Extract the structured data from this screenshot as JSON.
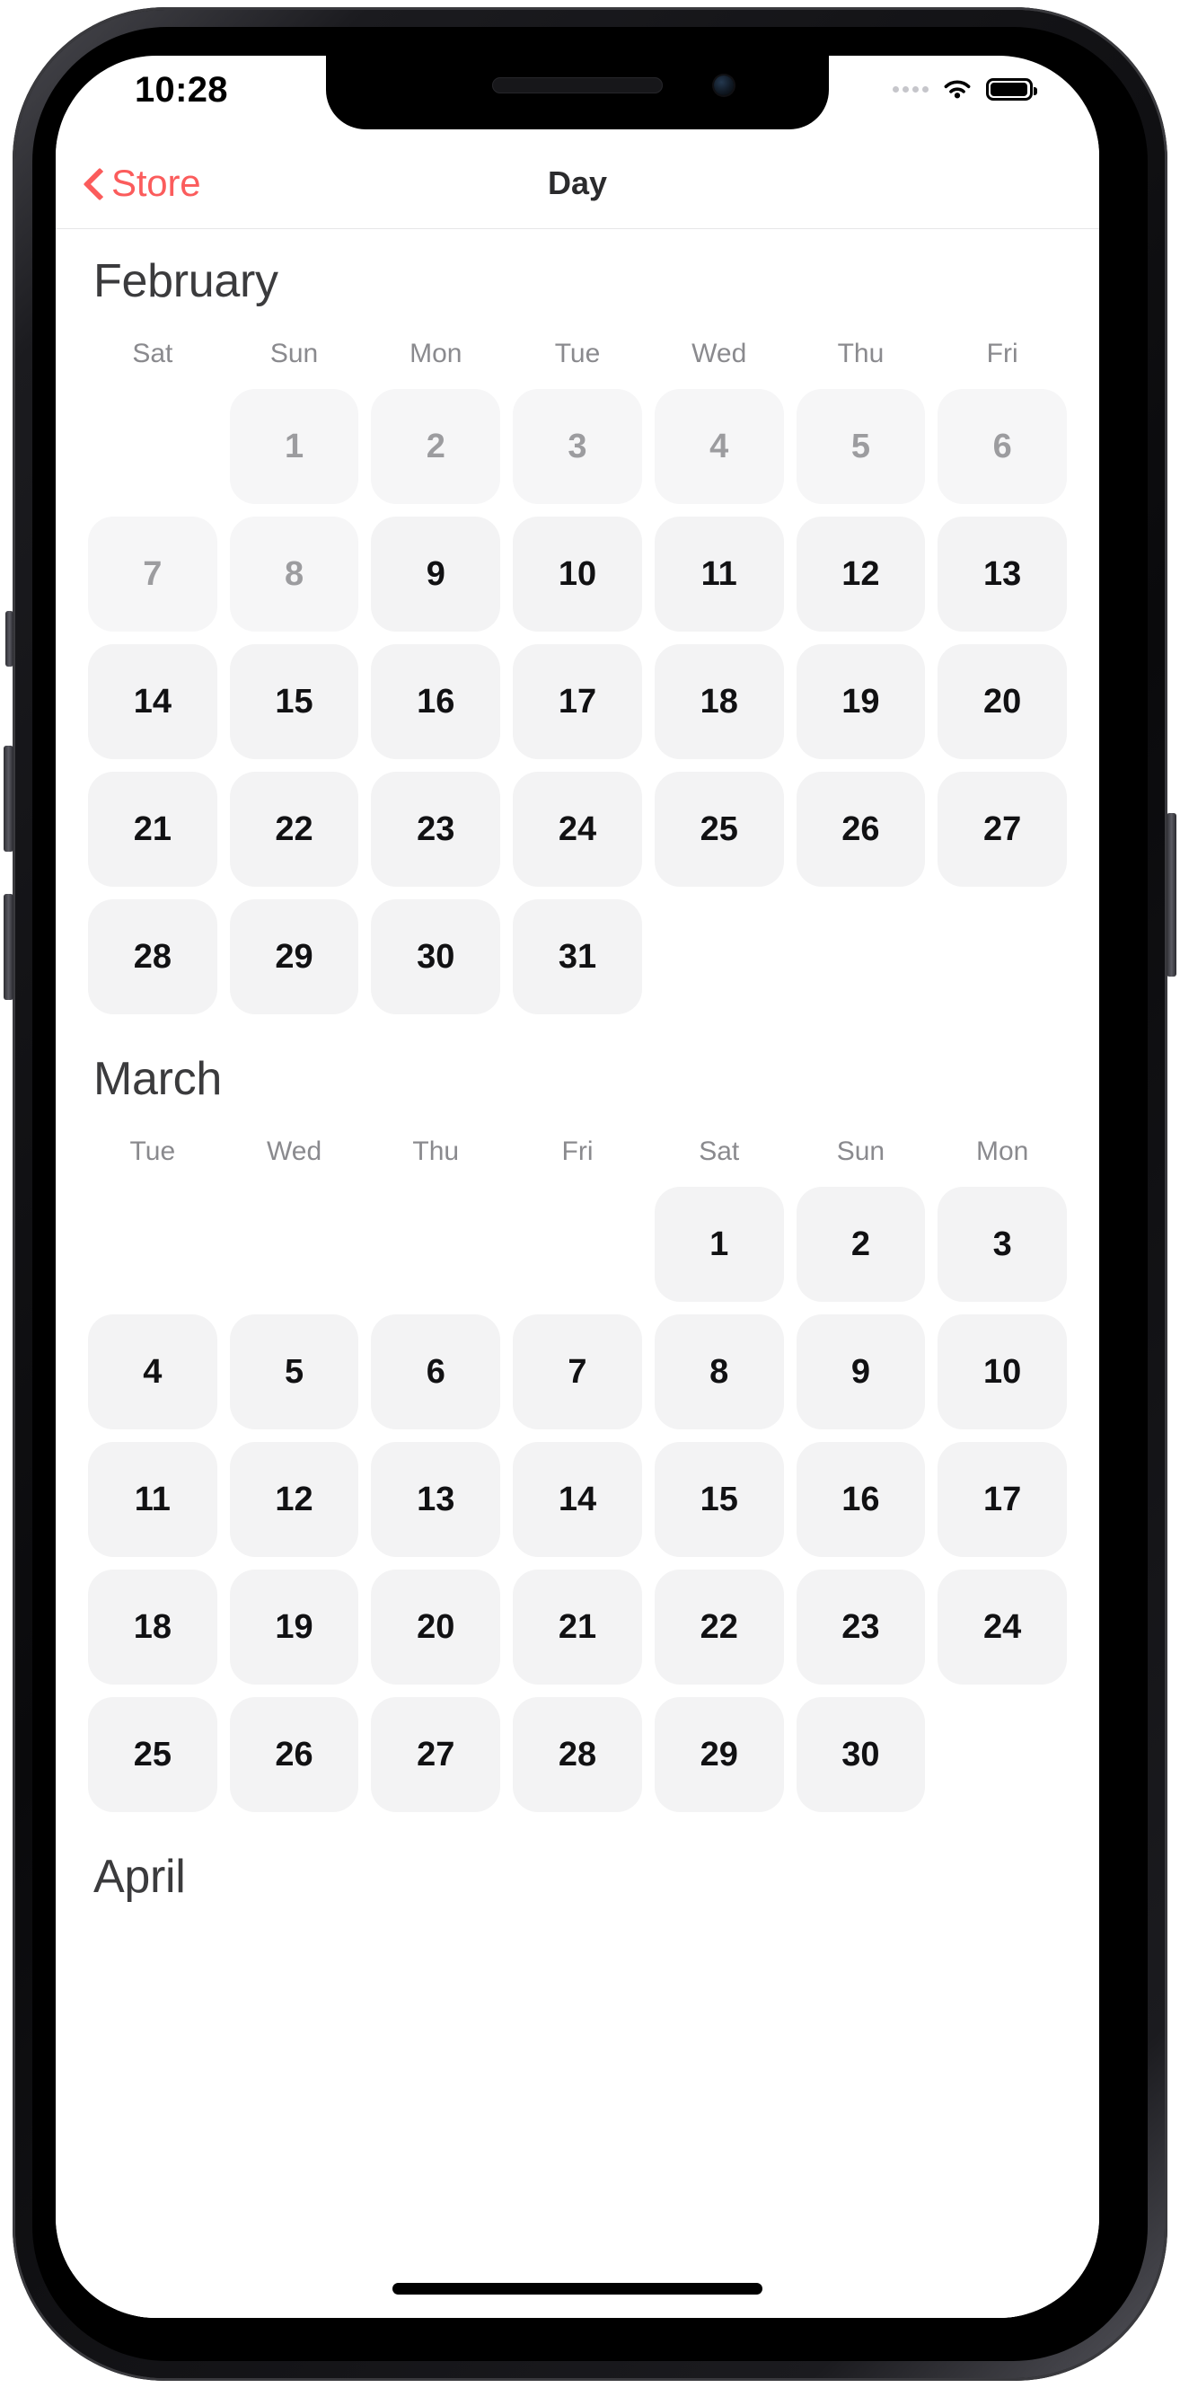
{
  "status_bar": {
    "time": "10:28",
    "signal_icon": "signal-dots-icon",
    "wifi_icon": "wifi-icon",
    "battery_icon": "battery-icon"
  },
  "nav_bar": {
    "back_icon": "chevron-left-icon",
    "back_label": "Store",
    "title": "Day"
  },
  "colors": {
    "accent": "#fb5c5c",
    "title_text": "#2b2b2d",
    "month_text": "#3b3b3d",
    "weekday_text": "#8a8a8e",
    "day_enabled_text": "#111113",
    "day_disabled_text": "#9c9c9f",
    "day_cell_bg": "#f3f3f4",
    "screen_bg": "#ffffff"
  },
  "months": [
    {
      "name": "February",
      "weekdays": [
        "Sat",
        "Sun",
        "Mon",
        "Tue",
        "Wed",
        "Thu",
        "Fri"
      ],
      "rows": [
        [
          {
            "label": "",
            "state": "empty"
          },
          {
            "label": "1",
            "state": "disabled"
          },
          {
            "label": "2",
            "state": "disabled"
          },
          {
            "label": "3",
            "state": "disabled"
          },
          {
            "label": "4",
            "state": "disabled"
          },
          {
            "label": "5",
            "state": "disabled"
          },
          {
            "label": "6",
            "state": "disabled"
          }
        ],
        [
          {
            "label": "7",
            "state": "disabled"
          },
          {
            "label": "8",
            "state": "disabled"
          },
          {
            "label": "9",
            "state": "enabled"
          },
          {
            "label": "10",
            "state": "enabled"
          },
          {
            "label": "11",
            "state": "enabled"
          },
          {
            "label": "12",
            "state": "enabled"
          },
          {
            "label": "13",
            "state": "enabled"
          }
        ],
        [
          {
            "label": "14",
            "state": "enabled"
          },
          {
            "label": "15",
            "state": "enabled"
          },
          {
            "label": "16",
            "state": "enabled"
          },
          {
            "label": "17",
            "state": "enabled"
          },
          {
            "label": "18",
            "state": "enabled"
          },
          {
            "label": "19",
            "state": "enabled"
          },
          {
            "label": "20",
            "state": "enabled"
          }
        ],
        [
          {
            "label": "21",
            "state": "enabled"
          },
          {
            "label": "22",
            "state": "enabled"
          },
          {
            "label": "23",
            "state": "enabled"
          },
          {
            "label": "24",
            "state": "enabled"
          },
          {
            "label": "25",
            "state": "enabled"
          },
          {
            "label": "26",
            "state": "enabled"
          },
          {
            "label": "27",
            "state": "enabled"
          }
        ],
        [
          {
            "label": "28",
            "state": "enabled"
          },
          {
            "label": "29",
            "state": "enabled"
          },
          {
            "label": "30",
            "state": "enabled"
          },
          {
            "label": "31",
            "state": "enabled"
          },
          {
            "label": "",
            "state": "empty"
          },
          {
            "label": "",
            "state": "empty"
          },
          {
            "label": "",
            "state": "empty"
          }
        ]
      ]
    },
    {
      "name": "March",
      "weekdays": [
        "Tue",
        "Wed",
        "Thu",
        "Fri",
        "Sat",
        "Sun",
        "Mon"
      ],
      "rows": [
        [
          {
            "label": "",
            "state": "empty"
          },
          {
            "label": "",
            "state": "empty"
          },
          {
            "label": "",
            "state": "empty"
          },
          {
            "label": "",
            "state": "empty"
          },
          {
            "label": "1",
            "state": "enabled"
          },
          {
            "label": "2",
            "state": "enabled"
          },
          {
            "label": "3",
            "state": "enabled"
          }
        ],
        [
          {
            "label": "4",
            "state": "enabled"
          },
          {
            "label": "5",
            "state": "enabled"
          },
          {
            "label": "6",
            "state": "enabled"
          },
          {
            "label": "7",
            "state": "enabled"
          },
          {
            "label": "8",
            "state": "enabled"
          },
          {
            "label": "9",
            "state": "enabled"
          },
          {
            "label": "10",
            "state": "enabled"
          }
        ],
        [
          {
            "label": "11",
            "state": "enabled"
          },
          {
            "label": "12",
            "state": "enabled"
          },
          {
            "label": "13",
            "state": "enabled"
          },
          {
            "label": "14",
            "state": "enabled"
          },
          {
            "label": "15",
            "state": "enabled"
          },
          {
            "label": "16",
            "state": "enabled"
          },
          {
            "label": "17",
            "state": "enabled"
          }
        ],
        [
          {
            "label": "18",
            "state": "enabled"
          },
          {
            "label": "19",
            "state": "enabled"
          },
          {
            "label": "20",
            "state": "enabled"
          },
          {
            "label": "21",
            "state": "enabled"
          },
          {
            "label": "22",
            "state": "enabled"
          },
          {
            "label": "23",
            "state": "enabled"
          },
          {
            "label": "24",
            "state": "enabled"
          }
        ],
        [
          {
            "label": "25",
            "state": "enabled"
          },
          {
            "label": "26",
            "state": "enabled"
          },
          {
            "label": "27",
            "state": "enabled"
          },
          {
            "label": "28",
            "state": "enabled"
          },
          {
            "label": "29",
            "state": "enabled"
          },
          {
            "label": "30",
            "state": "enabled"
          },
          {
            "label": "",
            "state": "empty"
          }
        ]
      ]
    },
    {
      "name": "April",
      "weekdays": [],
      "rows": []
    }
  ]
}
